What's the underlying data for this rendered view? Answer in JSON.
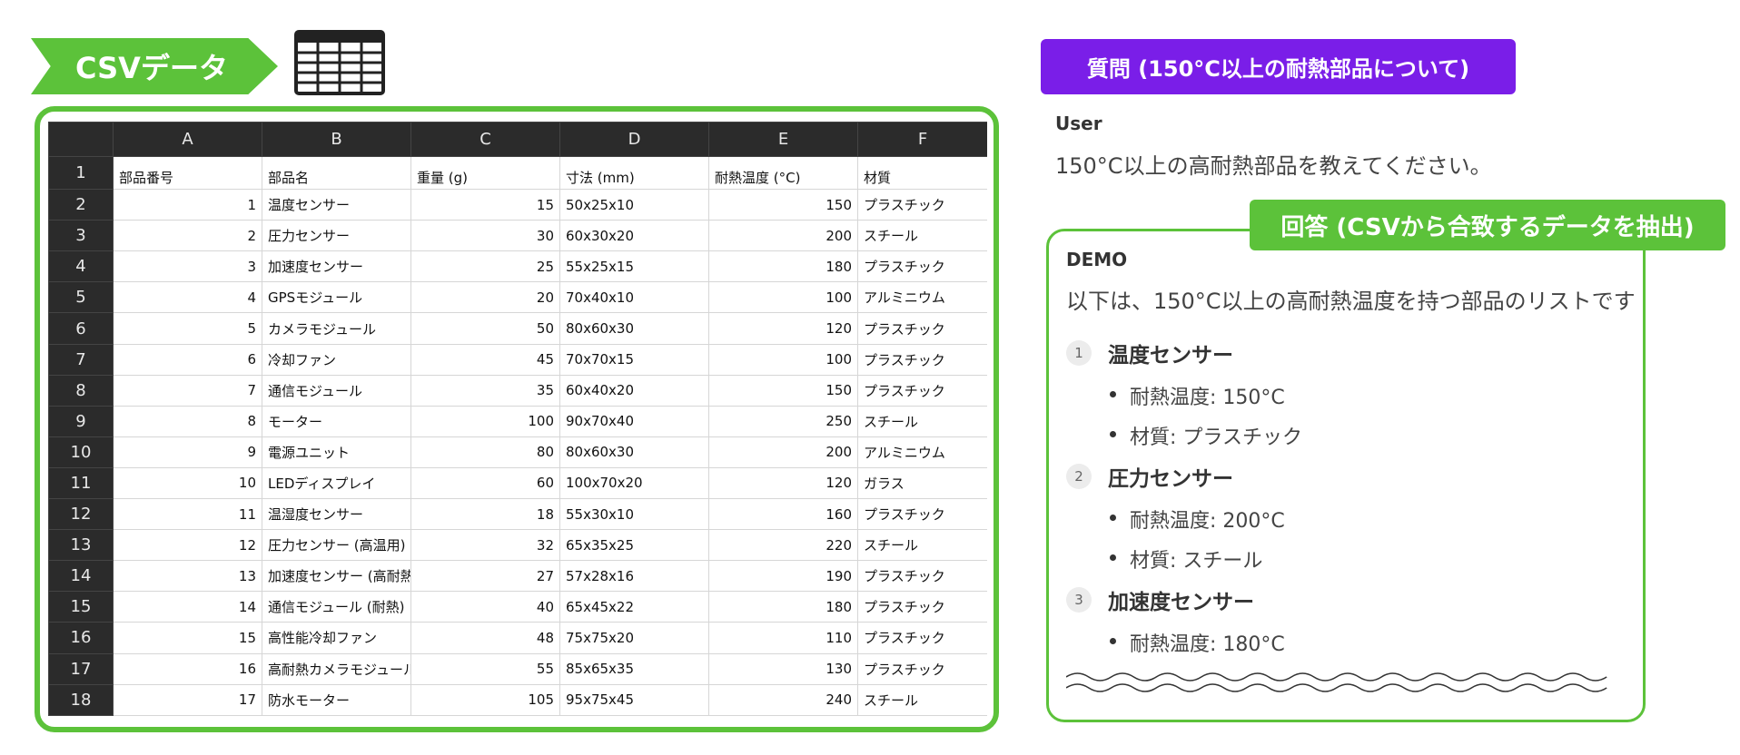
{
  "csv_section": {
    "title": "CSVデータ",
    "columns": [
      "A",
      "B",
      "C",
      "D",
      "E",
      "F"
    ],
    "header_row": {
      "num": "1",
      "cells": [
        "部品番号",
        "部品名",
        "重量 (g)",
        "寸法 (mm)",
        "耐熱温度 (°C)",
        "材質"
      ]
    },
    "rows": [
      {
        "num": "2",
        "id": "1",
        "name": "温度センサー",
        "weight": "15",
        "dims": "50x25x10",
        "temp": "150",
        "material": "プラスチック"
      },
      {
        "num": "3",
        "id": "2",
        "name": "圧力センサー",
        "weight": "30",
        "dims": "60x30x20",
        "temp": "200",
        "material": "スチール"
      },
      {
        "num": "4",
        "id": "3",
        "name": "加速度センサー",
        "weight": "25",
        "dims": "55x25x15",
        "temp": "180",
        "material": "プラスチック"
      },
      {
        "num": "5",
        "id": "4",
        "name": "GPSモジュール",
        "weight": "20",
        "dims": "70x40x10",
        "temp": "100",
        "material": "アルミニウム"
      },
      {
        "num": "6",
        "id": "5",
        "name": "カメラモジュール",
        "weight": "50",
        "dims": "80x60x30",
        "temp": "120",
        "material": "プラスチック"
      },
      {
        "num": "7",
        "id": "6",
        "name": "冷却ファン",
        "weight": "45",
        "dims": "70x70x15",
        "temp": "100",
        "material": "プラスチック"
      },
      {
        "num": "8",
        "id": "7",
        "name": "通信モジュール",
        "weight": "35",
        "dims": "60x40x20",
        "temp": "150",
        "material": "プラスチック"
      },
      {
        "num": "9",
        "id": "8",
        "name": "モーター",
        "weight": "100",
        "dims": "90x70x40",
        "temp": "250",
        "material": "スチール"
      },
      {
        "num": "10",
        "id": "9",
        "name": "電源ユニット",
        "weight": "80",
        "dims": "80x60x30",
        "temp": "200",
        "material": "アルミニウム"
      },
      {
        "num": "11",
        "id": "10",
        "name": "LEDディスプレイ",
        "weight": "60",
        "dims": "100x70x20",
        "temp": "120",
        "material": "ガラス"
      },
      {
        "num": "12",
        "id": "11",
        "name": "温湿度センサー",
        "weight": "18",
        "dims": "55x30x10",
        "temp": "160",
        "material": "プラスチック"
      },
      {
        "num": "13",
        "id": "12",
        "name": "圧力センサー (高温用)",
        "weight": "32",
        "dims": "65x35x25",
        "temp": "220",
        "material": "スチール"
      },
      {
        "num": "14",
        "id": "13",
        "name": "加速度センサー (高耐熱",
        "weight": "27",
        "dims": "57x28x16",
        "temp": "190",
        "material": "プラスチック"
      },
      {
        "num": "15",
        "id": "14",
        "name": "通信モジュール (耐熱)",
        "weight": "40",
        "dims": "65x45x22",
        "temp": "180",
        "material": "プラスチック"
      },
      {
        "num": "16",
        "id": "15",
        "name": "高性能冷却ファン",
        "weight": "48",
        "dims": "75x75x20",
        "temp": "110",
        "material": "プラスチック"
      },
      {
        "num": "17",
        "id": "16",
        "name": "高耐熱カメラモジュール",
        "weight": "55",
        "dims": "85x65x35",
        "temp": "130",
        "material": "プラスチック"
      },
      {
        "num": "18",
        "id": "17",
        "name": "防水モーター",
        "weight": "105",
        "dims": "95x75x45",
        "temp": "240",
        "material": "スチール"
      }
    ]
  },
  "question": {
    "badge": "質問 (150°C以上の耐熱部品について)",
    "role": "User",
    "text": "150°C以上の高耐熱部品を教えてください。"
  },
  "answer": {
    "badge": "回答 (CSVから合致するデータを抽出)",
    "role": "DEMO",
    "intro": "以下は、150°C以上の高耐熱温度を持つ部品のリストです",
    "items": [
      {
        "num": "1",
        "title": "温度センサー",
        "bullets": [
          "耐熱温度: 150°C",
          "材質: プラスチック"
        ]
      },
      {
        "num": "2",
        "title": "圧力センサー",
        "bullets": [
          "耐熱温度: 200°C",
          "材質: スチール"
        ]
      },
      {
        "num": "3",
        "title": "加速度センサー",
        "bullets": [
          "耐熱温度: 180°C"
        ]
      }
    ]
  },
  "colors": {
    "green": "#5cc23a",
    "purple": "#7a1ee8",
    "sheet_header": "#2b2b2b"
  },
  "icons": {
    "sheet": "spreadsheet-icon",
    "truncation": "wavy-lines-icon"
  }
}
